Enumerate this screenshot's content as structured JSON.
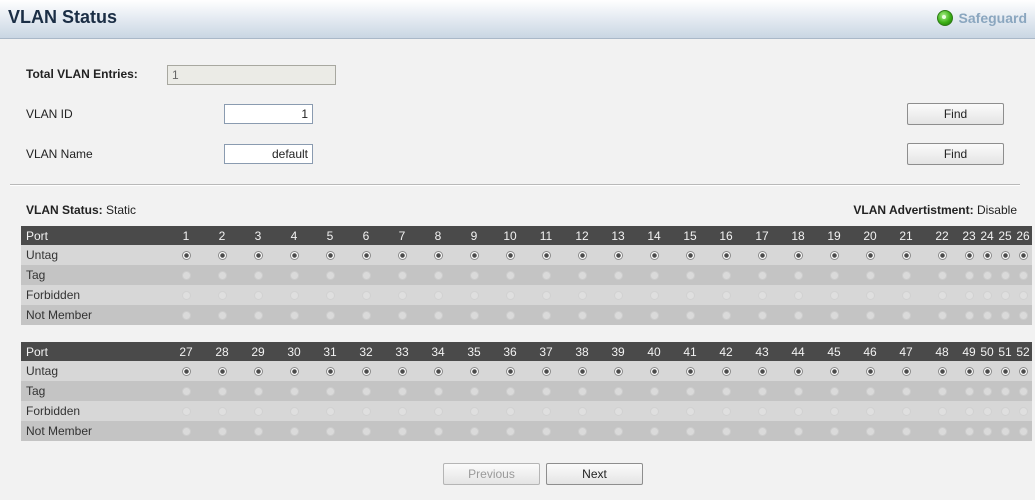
{
  "header": {
    "title": "VLAN Status",
    "safeguard_label": "Safeguard"
  },
  "form": {
    "total_label": "Total VLAN Entries:",
    "total_value": "1",
    "vlan_id_label": "VLAN ID",
    "vlan_id_value": "1",
    "vlan_name_label": "VLAN Name",
    "vlan_name_value": "default",
    "find_label": "Find"
  },
  "status": {
    "vlan_status_label": "VLAN Status:",
    "vlan_status_value": "Static",
    "advert_label": "VLAN Advertistment:",
    "advert_value": "Disable"
  },
  "table": {
    "port_label": "Port",
    "row_labels": [
      "Untag",
      "Tag",
      "Forbidden",
      "Not Member"
    ],
    "selected_row": "Untag",
    "blocks": [
      {
        "ports": [
          "1",
          "2",
          "3",
          "4",
          "5",
          "6",
          "7",
          "8",
          "9",
          "10",
          "11",
          "12",
          "13",
          "14",
          "15",
          "16",
          "17",
          "18",
          "19",
          "20",
          "21",
          "22",
          "23",
          "24",
          "25",
          "26"
        ]
      },
      {
        "ports": [
          "27",
          "28",
          "29",
          "30",
          "31",
          "32",
          "33",
          "34",
          "35",
          "36",
          "37",
          "38",
          "39",
          "40",
          "41",
          "42",
          "43",
          "44",
          "45",
          "46",
          "47",
          "48",
          "49",
          "50",
          "51",
          "52"
        ]
      }
    ]
  },
  "nav": {
    "previous_label": "Previous",
    "next_label": "Next"
  }
}
